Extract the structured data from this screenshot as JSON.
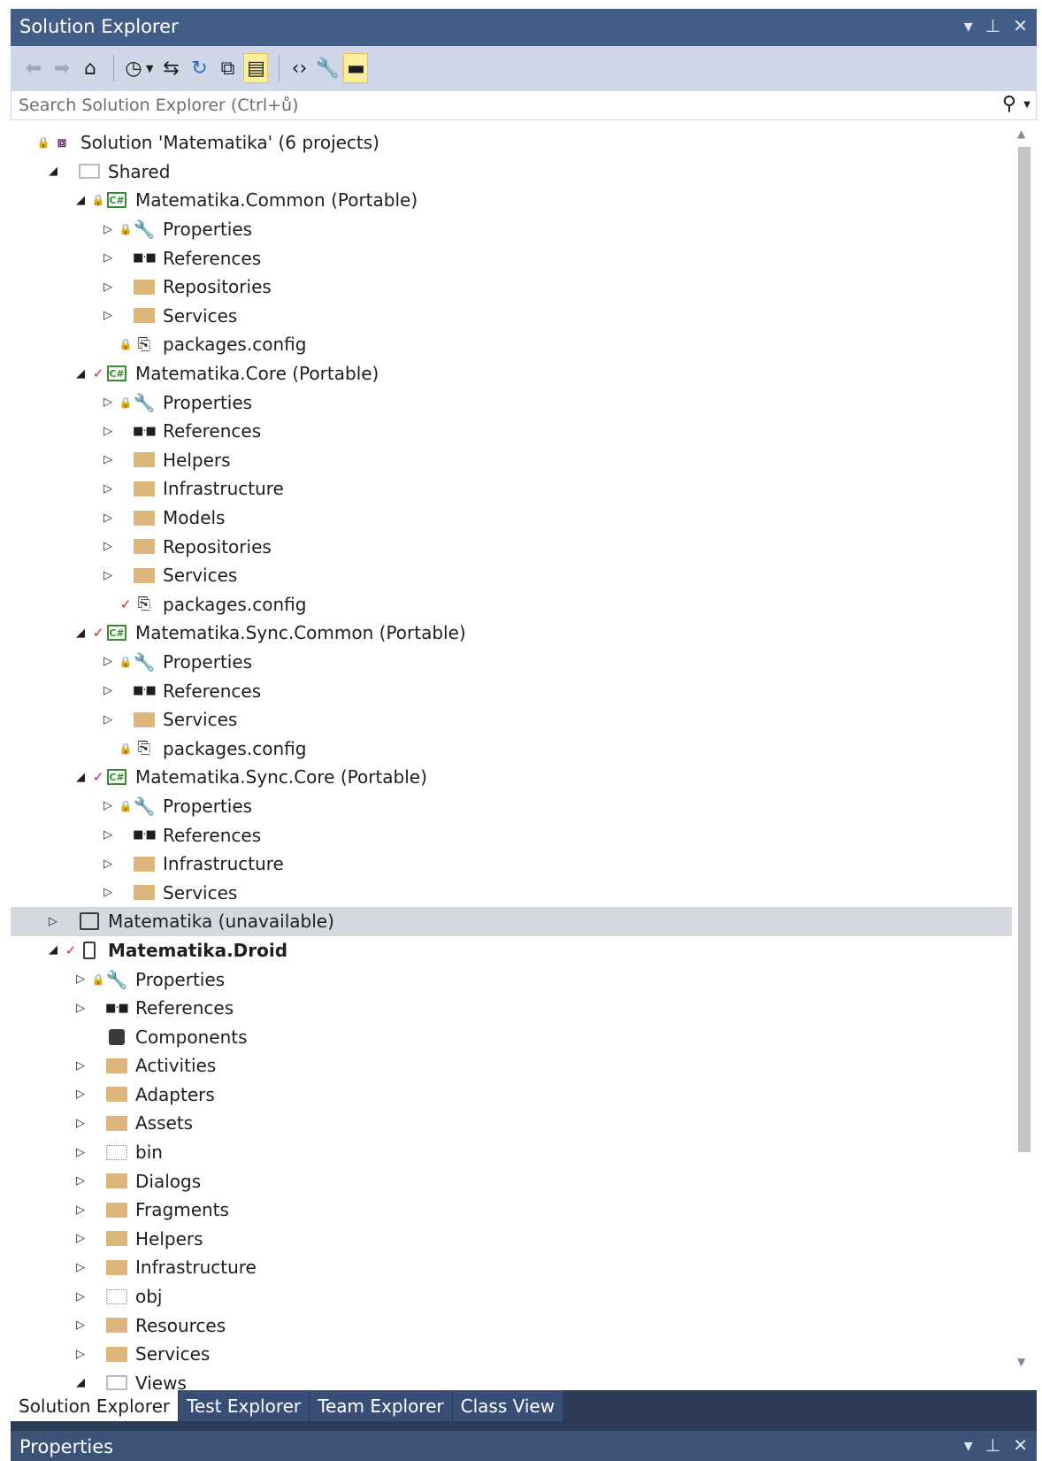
{
  "window": {
    "title": "Solution Explorer",
    "controls": [
      "▾",
      "⊥",
      "✕"
    ]
  },
  "search": {
    "placeholder": "Search Solution Explorer (Ctrl+ů)"
  },
  "tree": [
    {
      "label": "Solution 'Matematika' (6 projects)",
      "depth": 0,
      "twist": "",
      "overlay": "lock",
      "icon": "solution-icon"
    },
    {
      "label": "Shared",
      "depth": 1,
      "twist": "open",
      "overlay": "",
      "icon": "open-folder-icon"
    },
    {
      "label": "Matematika.Common (Portable)",
      "depth": 2,
      "twist": "open",
      "overlay": "lock",
      "icon": "csharp-project-icon"
    },
    {
      "label": "Properties",
      "depth": 3,
      "twist": "closed",
      "overlay": "lock",
      "icon": "wrench-icon"
    },
    {
      "label": "References",
      "depth": 3,
      "twist": "closed",
      "overlay": "",
      "icon": "references-icon"
    },
    {
      "label": "Repositories",
      "depth": 3,
      "twist": "closed",
      "overlay": "",
      "icon": "folder-icon"
    },
    {
      "label": "Services",
      "depth": 3,
      "twist": "closed",
      "overlay": "",
      "icon": "folder-icon"
    },
    {
      "label": "packages.config",
      "depth": 3,
      "twist": "",
      "overlay": "lock",
      "icon": "package-config-icon"
    },
    {
      "label": "Matematika.Core (Portable)",
      "depth": 2,
      "twist": "open",
      "overlay": "check",
      "icon": "csharp-project-icon"
    },
    {
      "label": "Properties",
      "depth": 3,
      "twist": "closed",
      "overlay": "lock",
      "icon": "wrench-icon"
    },
    {
      "label": "References",
      "depth": 3,
      "twist": "closed",
      "overlay": "",
      "icon": "references-icon"
    },
    {
      "label": "Helpers",
      "depth": 3,
      "twist": "closed",
      "overlay": "",
      "icon": "folder-icon"
    },
    {
      "label": "Infrastructure",
      "depth": 3,
      "twist": "closed",
      "overlay": "",
      "icon": "folder-icon"
    },
    {
      "label": "Models",
      "depth": 3,
      "twist": "closed",
      "overlay": "",
      "icon": "folder-icon"
    },
    {
      "label": "Repositories",
      "depth": 3,
      "twist": "closed",
      "overlay": "",
      "icon": "folder-icon"
    },
    {
      "label": "Services",
      "depth": 3,
      "twist": "closed",
      "overlay": "",
      "icon": "folder-icon"
    },
    {
      "label": "packages.config",
      "depth": 3,
      "twist": "",
      "overlay": "check",
      "icon": "package-config-icon"
    },
    {
      "label": "Matematika.Sync.Common (Portable)",
      "depth": 2,
      "twist": "open",
      "overlay": "check",
      "icon": "csharp-project-icon"
    },
    {
      "label": "Properties",
      "depth": 3,
      "twist": "closed",
      "overlay": "lock",
      "icon": "wrench-icon"
    },
    {
      "label": "References",
      "depth": 3,
      "twist": "closed",
      "overlay": "",
      "icon": "references-icon"
    },
    {
      "label": "Services",
      "depth": 3,
      "twist": "closed",
      "overlay": "",
      "icon": "folder-icon"
    },
    {
      "label": "packages.config",
      "depth": 3,
      "twist": "",
      "overlay": "lock",
      "icon": "package-config-icon"
    },
    {
      "label": "Matematika.Sync.Core (Portable)",
      "depth": 2,
      "twist": "open",
      "overlay": "check",
      "icon": "csharp-project-icon"
    },
    {
      "label": "Properties",
      "depth": 3,
      "twist": "closed",
      "overlay": "lock",
      "icon": "wrench-icon"
    },
    {
      "label": "References",
      "depth": 3,
      "twist": "closed",
      "overlay": "",
      "icon": "references-icon"
    },
    {
      "label": "Infrastructure",
      "depth": 3,
      "twist": "closed",
      "overlay": "",
      "icon": "folder-icon"
    },
    {
      "label": "Services",
      "depth": 3,
      "twist": "closed",
      "overlay": "",
      "icon": "folder-icon"
    },
    {
      "label": "Matematika (unavailable)",
      "depth": 1,
      "twist": "closed",
      "overlay": "",
      "icon": "shared-project-icon",
      "selected": true
    },
    {
      "label": "Matematika.Droid",
      "depth": 1,
      "twist": "open",
      "overlay": "check",
      "icon": "android-project-icon",
      "bold": true
    },
    {
      "label": "Properties",
      "depth": 2,
      "twist": "closed",
      "overlay": "lock",
      "icon": "wrench-icon"
    },
    {
      "label": "References",
      "depth": 2,
      "twist": "closed",
      "overlay": "",
      "icon": "references-icon"
    },
    {
      "label": "Components",
      "depth": 2,
      "twist": "",
      "overlay": "",
      "icon": "components-icon"
    },
    {
      "label": "Activities",
      "depth": 2,
      "twist": "closed",
      "overlay": "",
      "icon": "folder-icon"
    },
    {
      "label": "Adapters",
      "depth": 2,
      "twist": "closed",
      "overlay": "",
      "icon": "folder-icon"
    },
    {
      "label": "Assets",
      "depth": 2,
      "twist": "closed",
      "overlay": "",
      "icon": "folder-icon"
    },
    {
      "label": "bin",
      "depth": 2,
      "twist": "closed",
      "overlay": "",
      "icon": "excluded-folder-icon"
    },
    {
      "label": "Dialogs",
      "depth": 2,
      "twist": "closed",
      "overlay": "",
      "icon": "folder-icon"
    },
    {
      "label": "Fragments",
      "depth": 2,
      "twist": "closed",
      "overlay": "",
      "icon": "folder-icon"
    },
    {
      "label": "Helpers",
      "depth": 2,
      "twist": "closed",
      "overlay": "",
      "icon": "folder-icon"
    },
    {
      "label": "Infrastructure",
      "depth": 2,
      "twist": "closed",
      "overlay": "",
      "icon": "folder-icon"
    },
    {
      "label": "obj",
      "depth": 2,
      "twist": "closed",
      "overlay": "",
      "icon": "excluded-folder-icon"
    },
    {
      "label": "Resources",
      "depth": 2,
      "twist": "closed",
      "overlay": "",
      "icon": "folder-icon"
    },
    {
      "label": "Services",
      "depth": 2,
      "twist": "closed",
      "overlay": "",
      "icon": "folder-icon"
    },
    {
      "label": "Views",
      "depth": 2,
      "twist": "open",
      "overlay": "",
      "icon": "open-folder-icon"
    }
  ],
  "tabs": [
    {
      "label": "Solution Explorer",
      "active": true
    },
    {
      "label": "Test Explorer",
      "active": false
    },
    {
      "label": "Team Explorer",
      "active": false
    },
    {
      "label": "Class View",
      "active": false
    }
  ],
  "properties_panel": {
    "title": "Properties"
  },
  "colors": {
    "title_bar": "#425d88",
    "toolbar": "#cfd6e5",
    "selected_row": "#d6d8e0",
    "folder": "#dcb67a",
    "csharp_green": "#388a34",
    "lock_blue": "#1f6fd1",
    "check_red": "#cc1f1f"
  }
}
